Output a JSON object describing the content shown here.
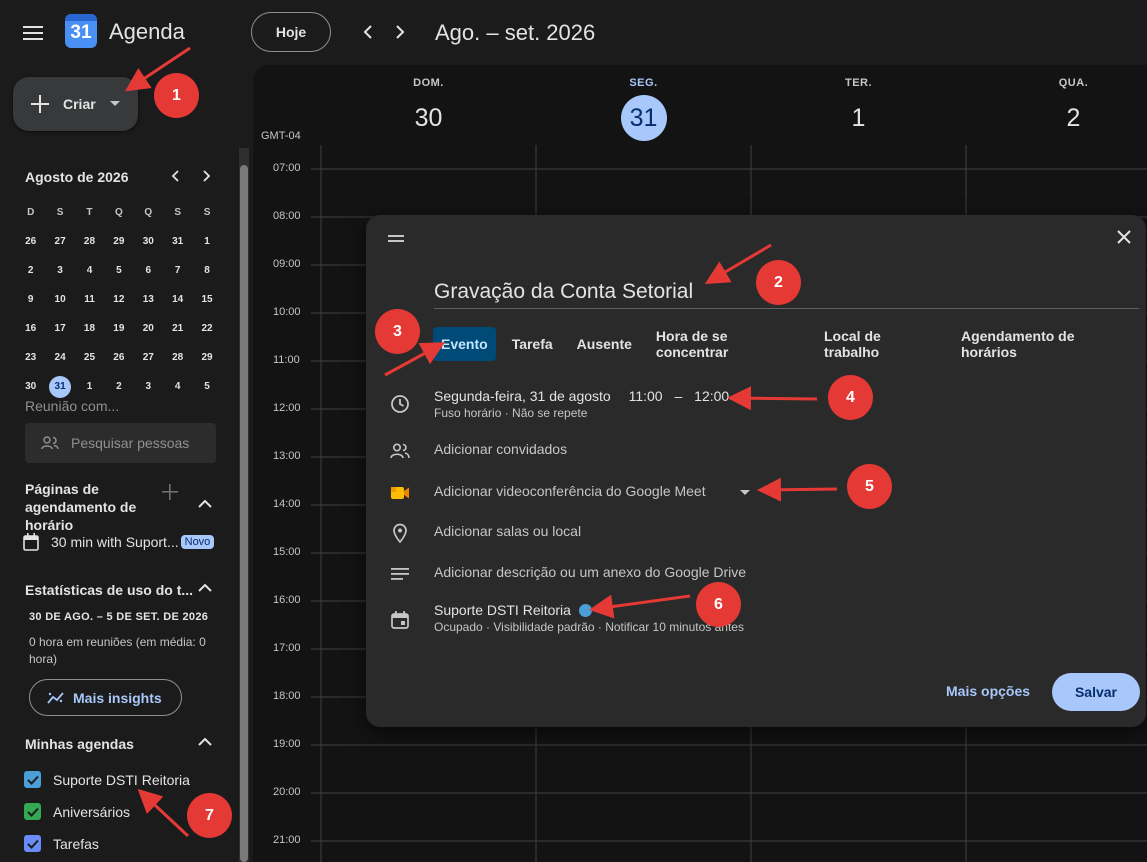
{
  "header": {
    "app_title": "Agenda",
    "logo_text": "31",
    "today_label": "Hoje",
    "range_title": "Ago. – set. 2026"
  },
  "create": {
    "label": "Criar"
  },
  "mini_calendar": {
    "title": "Agosto de 2026",
    "weekdays": [
      "D",
      "S",
      "T",
      "Q",
      "Q",
      "S",
      "S"
    ],
    "weeks": [
      [
        "26",
        "27",
        "28",
        "29",
        "30",
        "31",
        "1"
      ],
      [
        "2",
        "3",
        "4",
        "5",
        "6",
        "7",
        "8"
      ],
      [
        "9",
        "10",
        "11",
        "12",
        "13",
        "14",
        "15"
      ],
      [
        "16",
        "17",
        "18",
        "19",
        "20",
        "21",
        "22"
      ],
      [
        "23",
        "24",
        "25",
        "26",
        "27",
        "28",
        "29"
      ],
      [
        "30",
        "31",
        "1",
        "2",
        "3",
        "4",
        "5"
      ]
    ],
    "selected": "31"
  },
  "sidebar": {
    "meet_label": "Reunião com...",
    "people_search_placeholder": "Pesquisar pessoas",
    "booking_title": "Páginas de agendamento de horário",
    "booking_item": "30 min with Suport...",
    "booking_badge": "Novo",
    "stats_title": "Estatísticas de uso do t...",
    "stats_range": "30 DE AGO. – 5 DE SET. DE 2026",
    "stats_text": "0 hora em reuniões (em média: 0 hora)",
    "insights_label": "Mais insights",
    "my_calendars_title": "Minhas agendas",
    "calendars": [
      {
        "label": "Suporte DSTI Reitoria",
        "color": "#4a9fd8"
      },
      {
        "label": "Aniversários",
        "color": "#34a853"
      },
      {
        "label": "Tarefas",
        "color": "#6a8cf7"
      }
    ]
  },
  "grid": {
    "timezone": "GMT-04",
    "days": [
      {
        "name": "DOM.",
        "date": "30",
        "today": false
      },
      {
        "name": "SEG.",
        "date": "31",
        "today": true
      },
      {
        "name": "TER.",
        "date": "1",
        "today": false
      },
      {
        "name": "QUA.",
        "date": "2",
        "today": false
      }
    ],
    "hours": [
      "07:00",
      "08:00",
      "09:00",
      "10:00",
      "11:00",
      "12:00",
      "13:00",
      "14:00",
      "15:00",
      "16:00",
      "17:00",
      "18:00",
      "19:00",
      "20:00",
      "21:00"
    ]
  },
  "dialog": {
    "title_value": "Gravação da Conta Setorial",
    "tabs": [
      "Evento",
      "Tarefa",
      "Ausente",
      "Hora de se concentrar",
      "Local de trabalho",
      "Agendamento de horários"
    ],
    "active_tab": "Evento",
    "date_text": "Segunda-feira, 31 de agosto",
    "start_time": "11:00",
    "time_separator": "–",
    "end_time": "12:00",
    "time_sub": "Fuso horário · Não se repete",
    "guests": "Adicionar convidados",
    "meet": "Adicionar videoconferência do Google Meet",
    "location": "Adicionar salas ou local",
    "description": "Adicionar descrição ou um anexo do Google Drive",
    "calendar_name": "Suporte DSTI Reitoria",
    "calendar_color": "#4a9fd8",
    "calendar_sub": "Ocupado · Visibilidade padrão · Notificar 10 minutos antes",
    "more_options": "Mais opções",
    "save": "Salvar"
  },
  "annotations": [
    "1",
    "2",
    "3",
    "4",
    "5",
    "6",
    "7"
  ],
  "colors": {
    "accent": "#a8c7fa",
    "marker": "#e53935",
    "dialog_bg": "#2a2a2a",
    "page_bg": "#1b1b1b"
  }
}
